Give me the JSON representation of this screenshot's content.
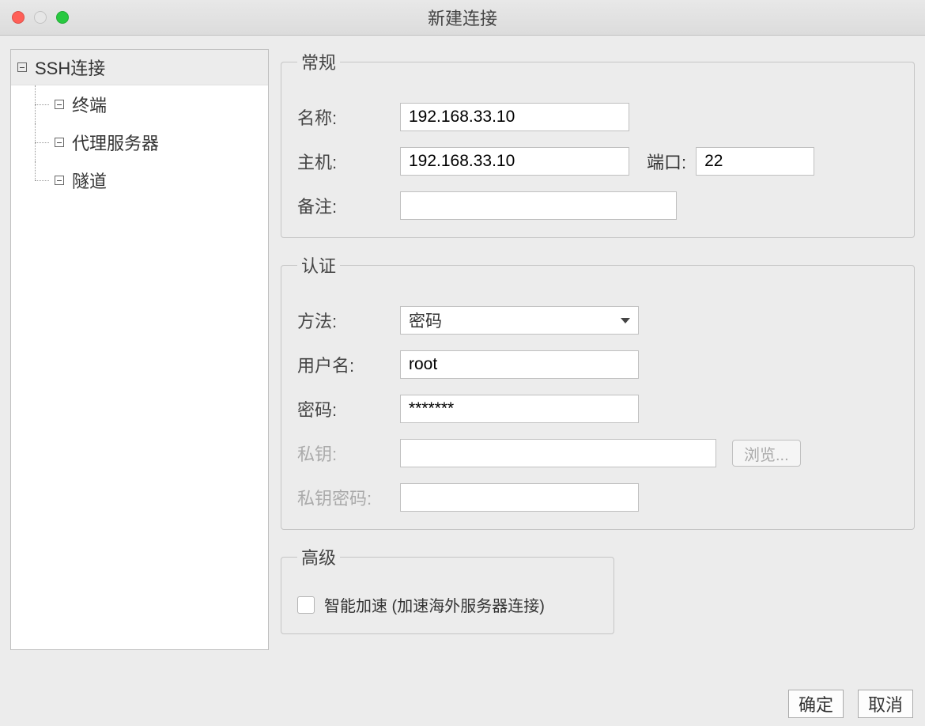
{
  "window": {
    "title": "新建连接"
  },
  "sidebar": {
    "root": "SSH连接",
    "items": [
      "终端",
      "代理服务器",
      "隧道"
    ]
  },
  "sections": {
    "general": {
      "legend": "常规",
      "name_label": "名称:",
      "name_value": "192.168.33.10",
      "host_label": "主机:",
      "host_value": "192.168.33.10",
      "port_label": "端口:",
      "port_value": "22",
      "note_label": "备注:",
      "note_value": ""
    },
    "auth": {
      "legend": "认证",
      "method_label": "方法:",
      "method_value": "密码",
      "user_label": "用户名:",
      "user_value": "root",
      "password_label": "密码:",
      "password_value": "*******",
      "key_label": "私钥:",
      "key_value": "",
      "browse_label": "浏览...",
      "keypass_label": "私钥密码:",
      "keypass_value": ""
    },
    "advanced": {
      "legend": "高级",
      "turbo_label": "智能加速 (加速海外服务器连接)"
    }
  },
  "buttons": {
    "ok": "确定",
    "cancel": "取消"
  }
}
